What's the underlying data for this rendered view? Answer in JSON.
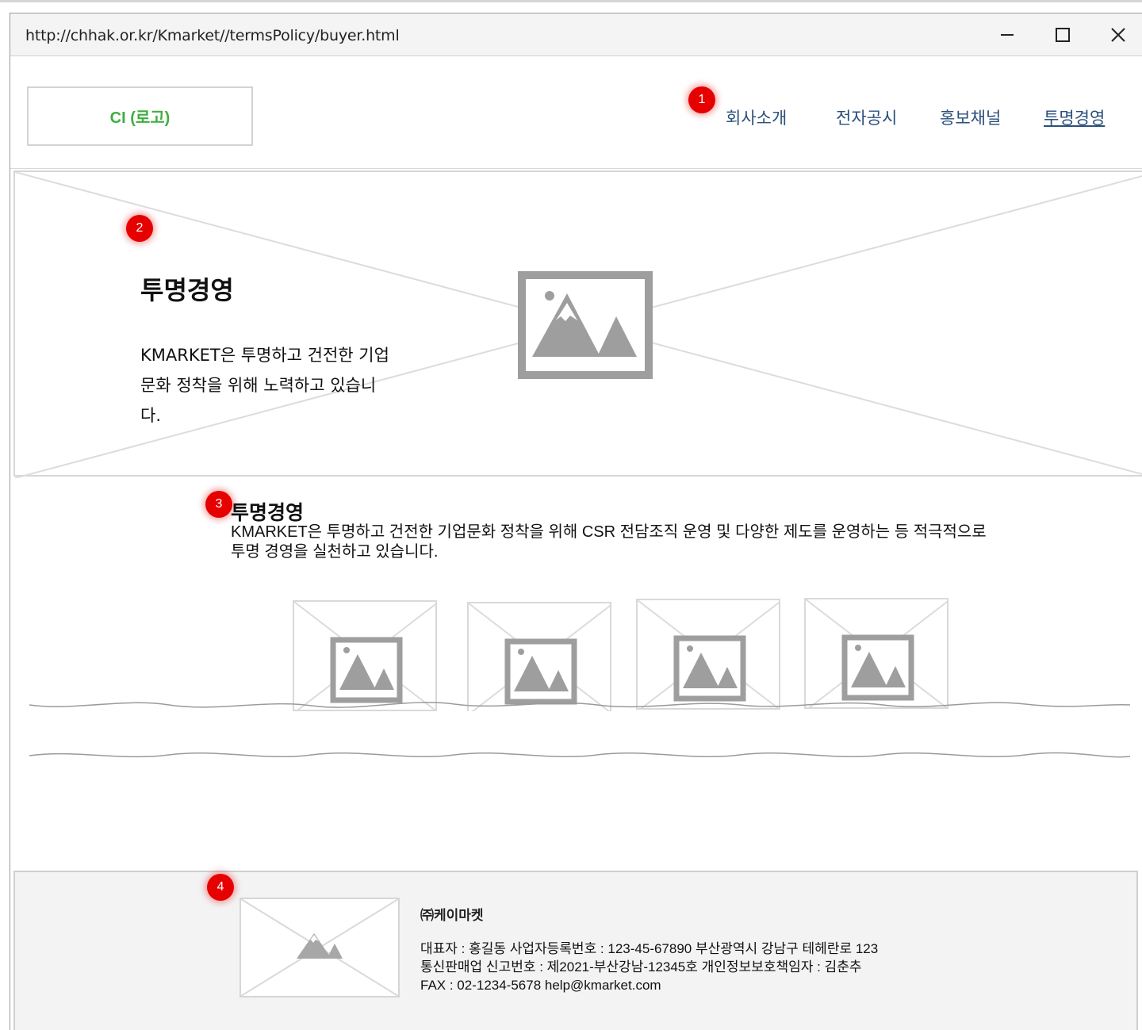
{
  "window": {
    "url": "http://chhak.or.kr/Kmarket//termsPolicy/buyer.html"
  },
  "header": {
    "logo_label": "CI (로고)",
    "nav": [
      "회사소개",
      "전자공시",
      "홍보채널",
      "투명경영"
    ],
    "active_nav": "투명경영"
  },
  "badges": [
    "1",
    "2",
    "3",
    "4"
  ],
  "hero": {
    "title": "투명경영",
    "text": "KMARKET은 투명하고 건전한 기업문화 정착을 위해 노력하고 있습니다."
  },
  "section": {
    "title": "투명경영",
    "text": "KMARKET은 투명하고 건전한 기업문화 정착을 위해 CSR 전담조직 운영 및 다양한 제도를 운영하는 등 적극적으로 투명 경영을 실천하고 있습니다."
  },
  "footer": {
    "company": "㈜케이마켓",
    "info": "대표자 : 홍길동 사업자등록번호 : 123-45-67890 부산광역시 강남구 테헤란로 123 통신판매업 신고번호 : 제2021-부산강남-12345호 개인정보보호책임자 : 김춘추 FAX : 02-1234-5678 help@kmarket.com"
  }
}
